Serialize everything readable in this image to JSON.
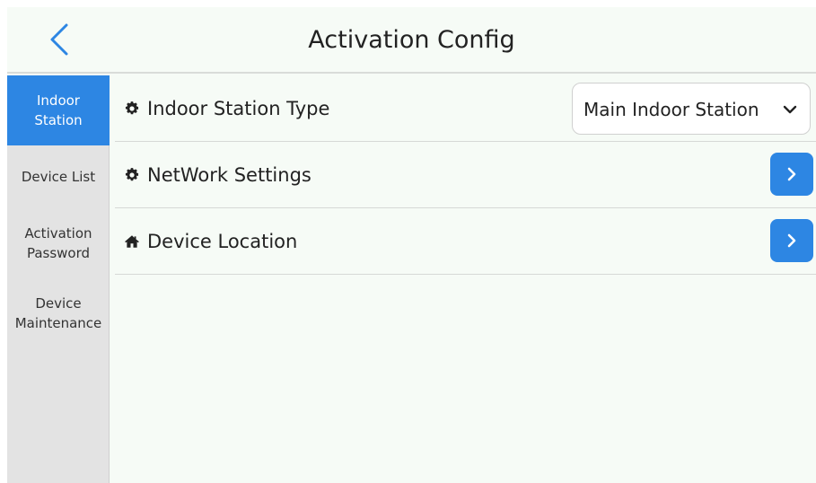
{
  "header": {
    "title": "Activation Config",
    "back_icon": "chevron-left-icon"
  },
  "sidebar": {
    "items": [
      {
        "label": "Indoor\nStation",
        "active": true
      },
      {
        "label": "Device List",
        "active": false
      },
      {
        "label": "Activation\nPassword",
        "active": false
      },
      {
        "label": "Device\nMaintenance",
        "active": false
      }
    ]
  },
  "settings": {
    "station_type": {
      "label": "Indoor Station Type",
      "icon": "gear-icon",
      "value": "Main Indoor Station"
    },
    "network": {
      "label": "NetWork Settings",
      "icon": "gear-icon"
    },
    "location": {
      "label": "Device Location",
      "icon": "home-icon"
    }
  },
  "colors": {
    "accent": "#2d86e3",
    "background": "#f6fbf6",
    "sidebar": "#e3e3e3"
  }
}
